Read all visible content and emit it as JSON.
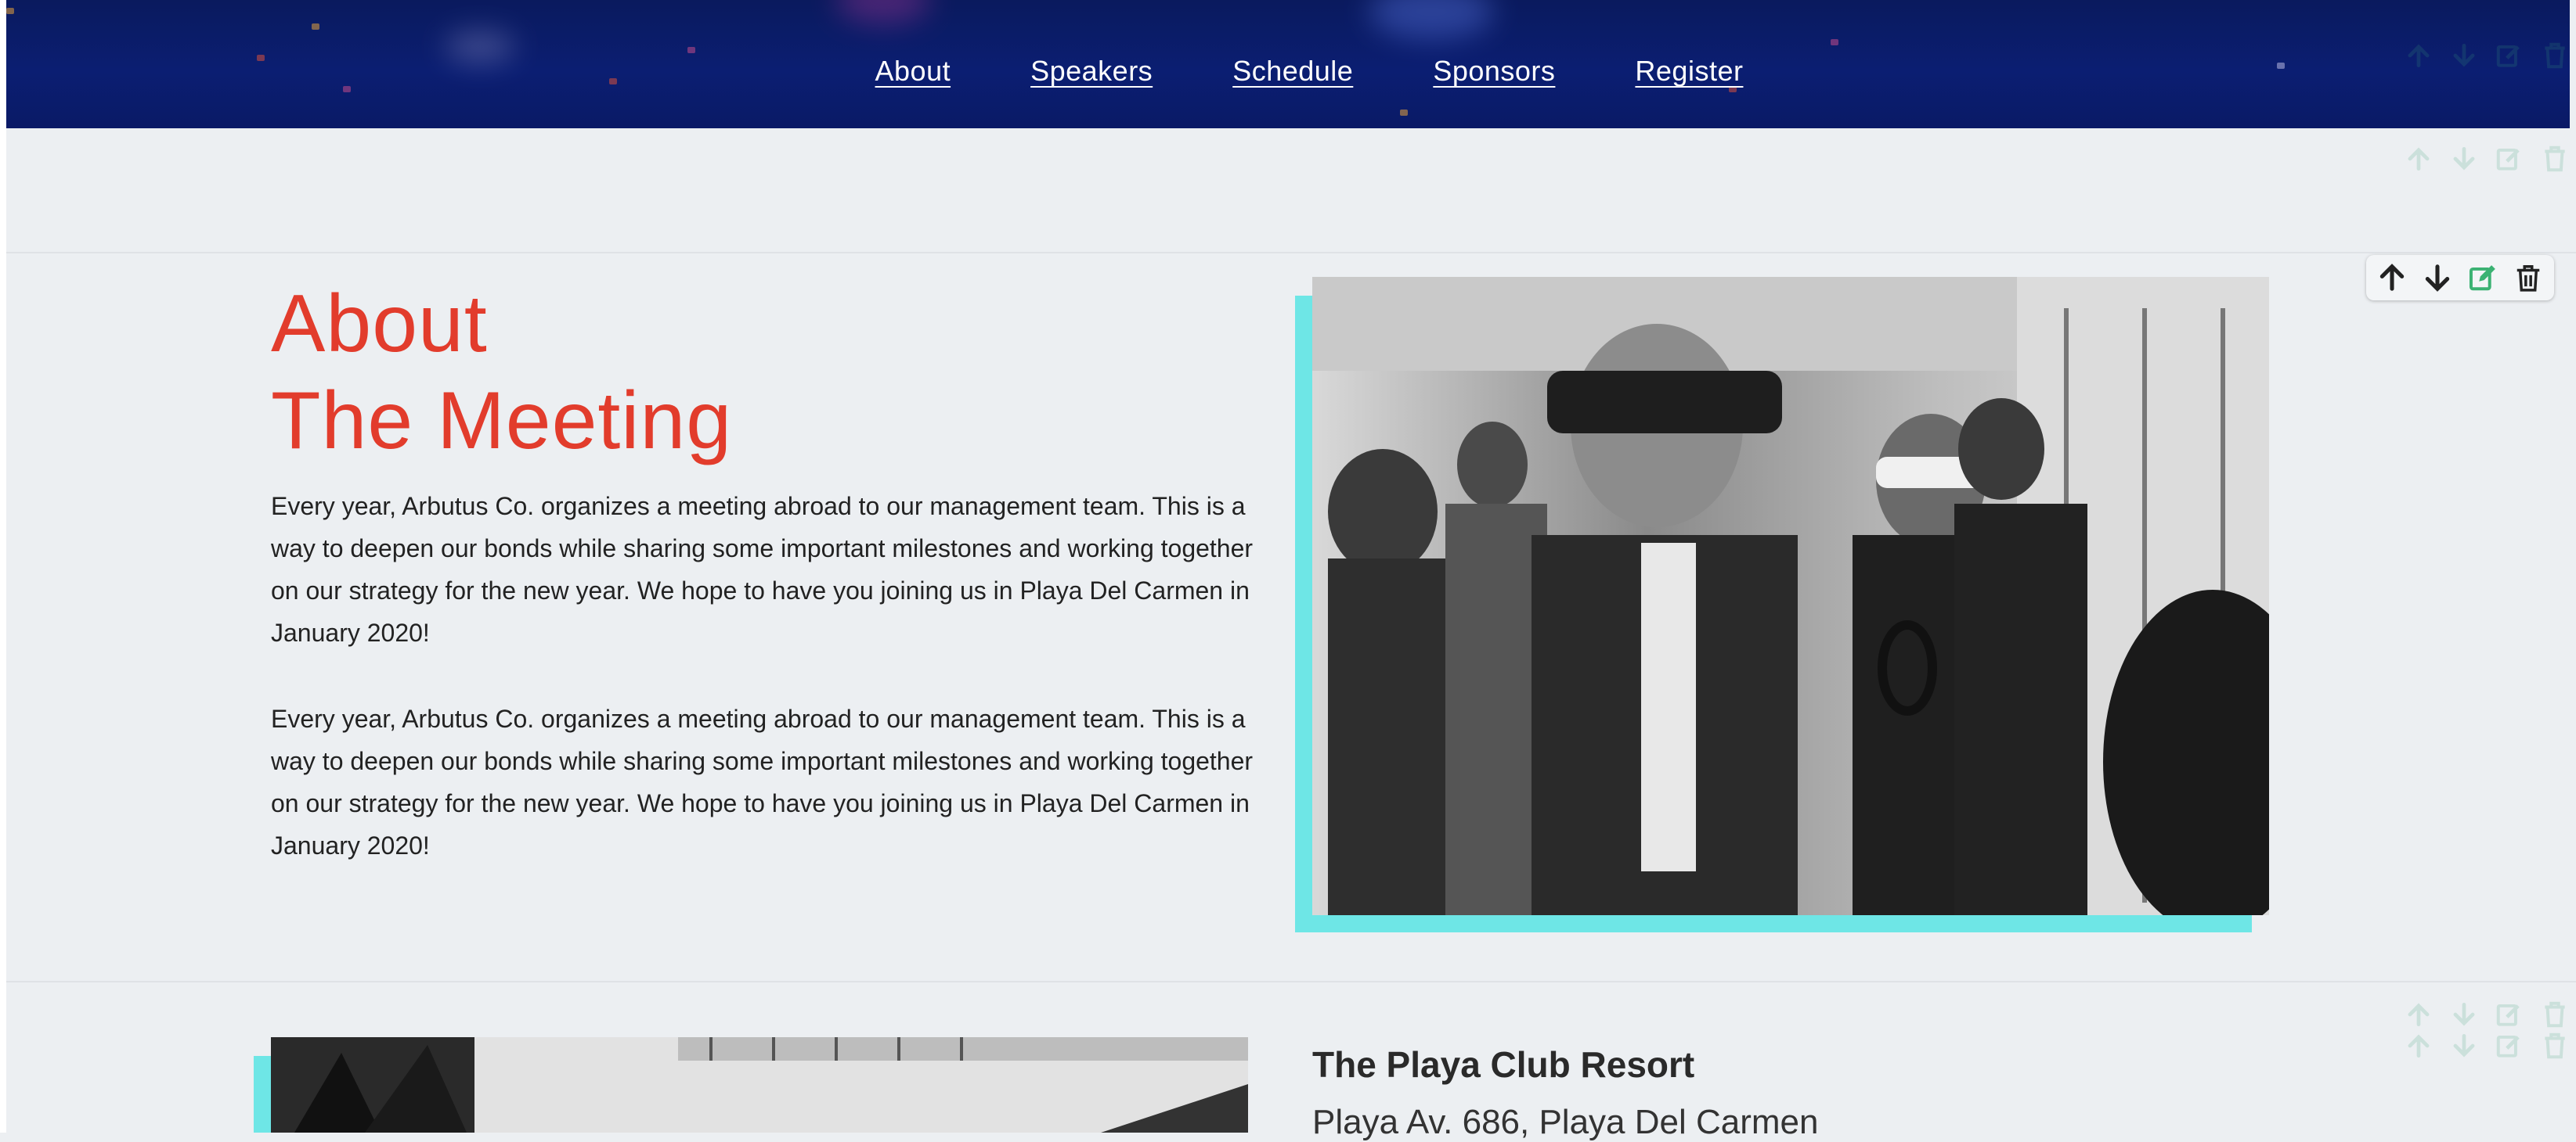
{
  "nav": {
    "links": [
      "About",
      "Speakers",
      "Schedule",
      "Sponsors",
      "Register"
    ]
  },
  "about": {
    "title_line1": "About",
    "title_line2": "The Meeting",
    "paragraph1": "Every year, Arbutus Co. organizes a meeting abroad to our management team. This is a way to deepen our bonds while sharing some important milestones and working together on our strategy for the new year. We hope to have you joining us in Playa Del Carmen in January 2020!",
    "paragraph2": "Every year, Arbutus Co. organizes a meeting abroad to our management team. This is a way to deepen our bonds while sharing some important milestones and working together on our strategy for the new year. We hope to have you joining us in Playa Del Carmen in January 2020!"
  },
  "venue": {
    "name": "The Playa Club Resort",
    "address": "Playa Av. 686, Playa Del Carmen"
  },
  "controls": {
    "icons": [
      "arrow-up-icon",
      "arrow-down-icon",
      "edit-icon",
      "trash-icon"
    ],
    "edit_color": "#3bb273"
  },
  "colors": {
    "nav_bg": "#0b1e72",
    "title": "#e23c2c",
    "accent": "#6ee6e6",
    "page_bg": "#eceff2"
  }
}
